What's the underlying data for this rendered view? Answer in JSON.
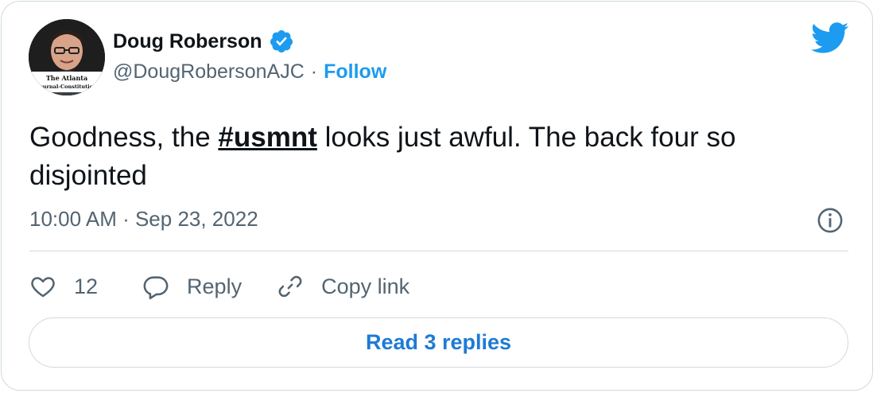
{
  "author": {
    "name": "Doug Roberson",
    "handle": "@DougRobersonAJC",
    "separator": "·",
    "follow_label": "Follow",
    "avatar_caption_line1": "The Atlanta",
    "avatar_caption_line2": "Journal-Constitution"
  },
  "tweet": {
    "text_before": "Goodness, the ",
    "hashtag": "#usmnt",
    "text_after": " looks just awful. The back four so disjointed",
    "timestamp": "10:00 AM · Sep 23, 2022"
  },
  "actions": {
    "like_count": "12",
    "reply_label": "Reply",
    "copy_link_label": "Copy link"
  },
  "read_replies_label": "Read 3 replies",
  "icons": {
    "brand": "twitter-bird-icon",
    "verified": "verified-badge-icon",
    "info": "info-icon",
    "like": "heart-icon",
    "reply": "speech-bubble-icon",
    "copy": "link-icon"
  },
  "colors": {
    "accent": "#1d9bf0",
    "text": "#0f1419",
    "muted": "#536471",
    "border": "#cfd9de"
  }
}
